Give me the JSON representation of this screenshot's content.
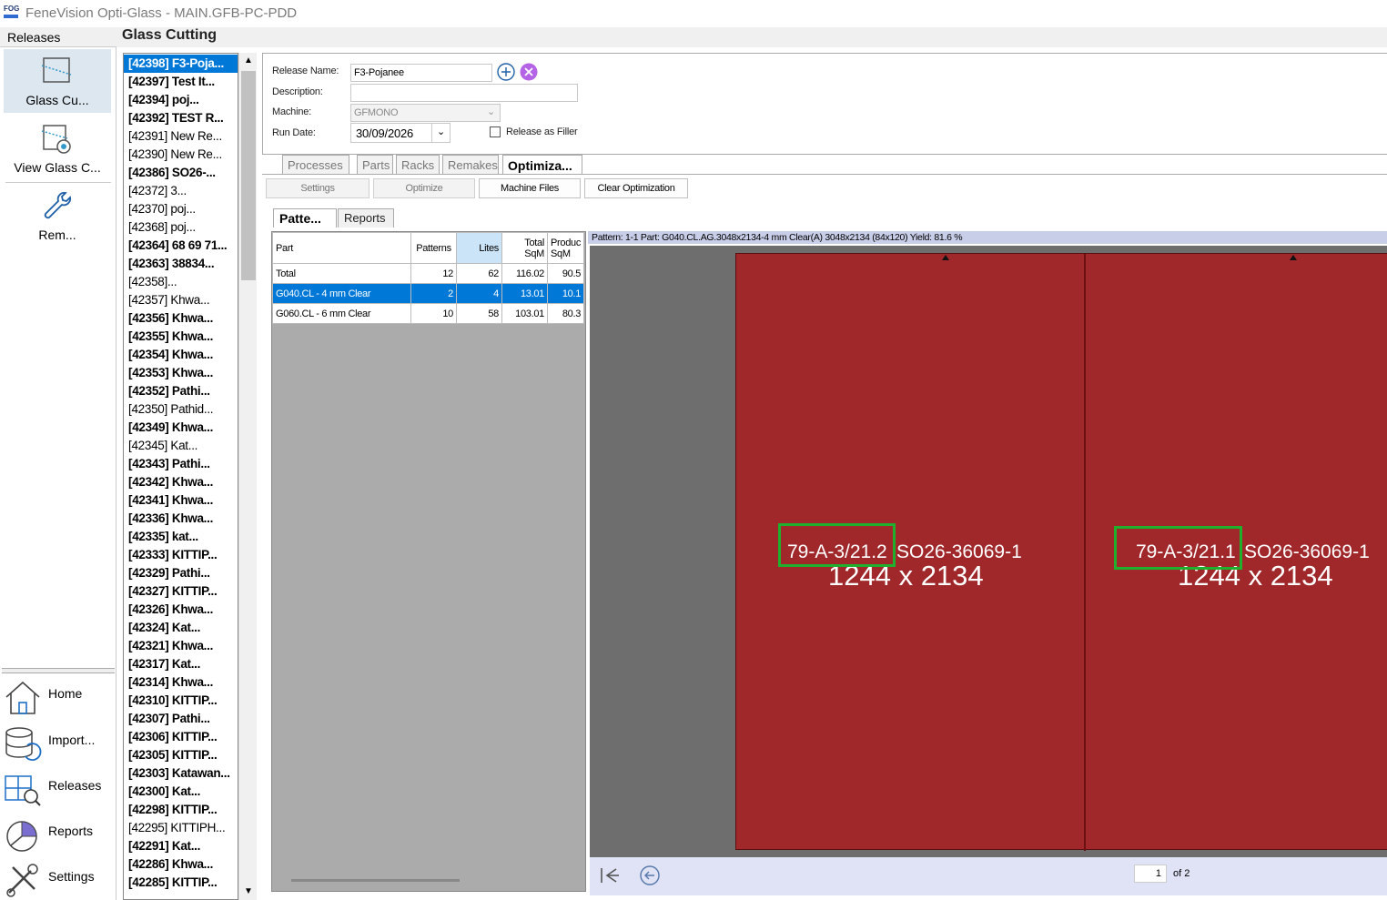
{
  "window": {
    "title": "FeneVision Opti-Glass - MAIN.GFB-PC-PDD",
    "logo_text": "FOG"
  },
  "left_header": "Releases",
  "nav_top": [
    {
      "label": "Glass Cu...",
      "icon": "glass-cutting-icon"
    },
    {
      "label": "View Glass C...",
      "icon": "view-glass-icon"
    },
    {
      "label": "Rem...",
      "icon": "wrench-icon"
    }
  ],
  "nav_bottom": [
    {
      "label": "Home",
      "icon": "home-icon"
    },
    {
      "label": "Import...",
      "icon": "database-import-icon"
    },
    {
      "label": "Releases",
      "icon": "releases-search-icon"
    },
    {
      "label": "Reports",
      "icon": "pie-chart-icon"
    },
    {
      "label": "Settings",
      "icon": "tools-icon"
    }
  ],
  "main_header": "Glass Cutting",
  "releases": [
    {
      "t": "[42398] F3-Poja...",
      "b": true
    },
    {
      "t": "[42397] Test It...",
      "b": true
    },
    {
      "t": "[42394] poj...",
      "b": true
    },
    {
      "t": "[42392] TEST R...",
      "b": true
    },
    {
      "t": "[42391] New Re...",
      "b": false
    },
    {
      "t": "[42390] New Re...",
      "b": false
    },
    {
      "t": "[42386] SO26-...",
      "b": true
    },
    {
      "t": "[42372] 3...",
      "b": false
    },
    {
      "t": "[42370] poj...",
      "b": false
    },
    {
      "t": "[42368] poj...",
      "b": false
    },
    {
      "t": "[42364] 68 69 71...",
      "b": true
    },
    {
      "t": "[42363] 38834...",
      "b": true
    },
    {
      "t": "[42358]...",
      "b": false
    },
    {
      "t": "[42357] Khwa...",
      "b": false
    },
    {
      "t": "[42356] Khwa...",
      "b": true
    },
    {
      "t": "[42355] Khwa...",
      "b": true
    },
    {
      "t": "[42354] Khwa...",
      "b": true
    },
    {
      "t": "[42353] Khwa...",
      "b": true
    },
    {
      "t": "[42352] Pathi...",
      "b": true
    },
    {
      "t": "[42350] Pathid...",
      "b": false
    },
    {
      "t": "[42349] Khwa...",
      "b": true
    },
    {
      "t": "[42345] Kat...",
      "b": false
    },
    {
      "t": "[42343] Pathi...",
      "b": true
    },
    {
      "t": "[42342] Khwa...",
      "b": true
    },
    {
      "t": "[42341] Khwa...",
      "b": true
    },
    {
      "t": "[42336] Khwa...",
      "b": true
    },
    {
      "t": "[42335] kat...",
      "b": true
    },
    {
      "t": "[42333] KITTIP...",
      "b": true
    },
    {
      "t": "[42329] Pathi...",
      "b": true
    },
    {
      "t": "[42327] KITTIP...",
      "b": true
    },
    {
      "t": "[42326] Khwa...",
      "b": true
    },
    {
      "t": "[42324] Kat...",
      "b": true
    },
    {
      "t": "[42321] Khwa...",
      "b": true
    },
    {
      "t": "[42317] Kat...",
      "b": true
    },
    {
      "t": "[42314] Khwa...",
      "b": true
    },
    {
      "t": "[42310] KITTIP...",
      "b": true
    },
    {
      "t": "[42307] Pathi...",
      "b": true
    },
    {
      "t": "[42306] KITTIP...",
      "b": true
    },
    {
      "t": "[42305] KITTIP...",
      "b": true
    },
    {
      "t": "[42303] Katawan...",
      "b": true
    },
    {
      "t": "[42300] Kat...",
      "b": true
    },
    {
      "t": "[42298] KITTIP...",
      "b": true
    },
    {
      "t": "[42295] KITTIPH...",
      "b": false
    },
    {
      "t": "[42291] Kat...",
      "b": true
    },
    {
      "t": "[42286] Khwa...",
      "b": true
    },
    {
      "t": "[42285] KITTIP...",
      "b": true
    }
  ],
  "form": {
    "release_name_label": "Release Name:",
    "release_name_value": "F3-Pojanee",
    "description_label": "Description:",
    "description_value": "",
    "machine_label": "Machine:",
    "machine_value": "GFMONO",
    "run_date_label": "Run Date:",
    "run_date_value": "30/09/2026",
    "filler_label": "Release as Filler"
  },
  "tabs": [
    "Processes",
    "Parts",
    "Racks",
    "Remakes",
    "Optimiza..."
  ],
  "toolbar": [
    "Settings",
    "Optimize",
    "Machine Files",
    "Clear Optimization"
  ],
  "subtabs": [
    "Patte...",
    "Reports"
  ],
  "grid": {
    "headers": [
      "Part",
      "Patterns",
      "Lites",
      "Total SqM",
      "Produc SqM"
    ],
    "rows": [
      [
        "Total",
        "12",
        "62",
        "116.02",
        "90.5"
      ],
      [
        "G040.CL - 4 mm Clear",
        "2",
        "4",
        "13.01",
        "10.1"
      ],
      [
        "G060.CL - 6 mm Clear",
        "10",
        "58",
        "103.01",
        "80.3"
      ]
    ]
  },
  "preview": {
    "header": "Pattern: 1-1    Part: G040.CL.AG.3048x2134-4 mm Clear(A) 3048x2134 (84x120)    Yield: 81.6 %",
    "pieces": [
      {
        "code": "79-A-3/21.2",
        "order": "SO26-36069-1",
        "size": "1244 x 2134"
      },
      {
        "code": "79-A-3/21.1",
        "order": "SO26-36069-1",
        "size": "1244 x 2134"
      }
    ],
    "sheet_color": "#a0282b",
    "highlight_color": "#1fb02e"
  },
  "pager": {
    "current": "1",
    "of": "of 2"
  }
}
